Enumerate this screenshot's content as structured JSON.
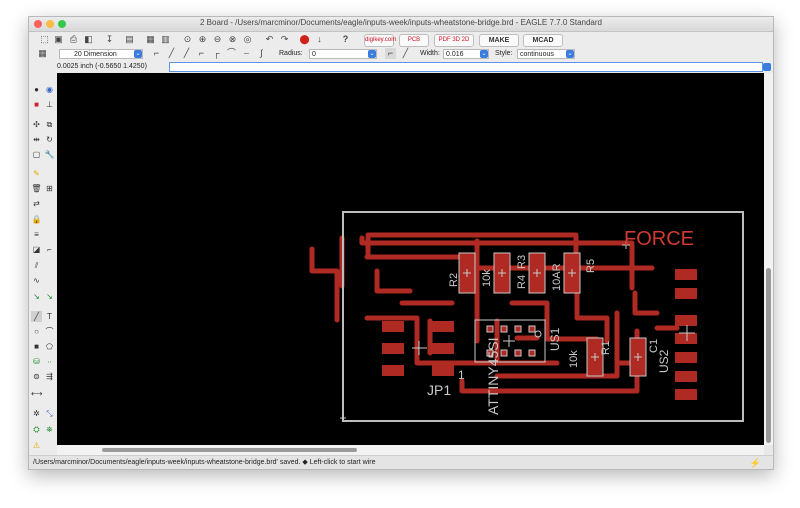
{
  "window": {
    "title": "2 Board - /Users/marcminor/Documents/eagle/inputs-week/inputs-wheatstone-bridge.brd - EAGLE 7.7.0 Standard"
  },
  "toolbar": {
    "buttons": [
      "digikey.com",
      "PCB quote",
      "PDF 3D 2D",
      "MAKE",
      "MCAD"
    ]
  },
  "props": {
    "layer": "20 Dimension",
    "radius_label": "Radius:",
    "radius_value": "0",
    "width_label": "Width:",
    "width_value": "0.016",
    "style_label": "Style:",
    "style_value": "continuous"
  },
  "cmd": {
    "coordinates": "0.0025 inch (-0.5650 1.4250)",
    "command": ""
  },
  "board": {
    "labels": {
      "force": "FORCE",
      "r2": "R2",
      "val10k_a": "10k",
      "r4": "R4",
      "r3": "R3",
      "val10ar": "10AR",
      "r5": "R5",
      "us1": "US1",
      "val10k_b": "10k",
      "r1": "R1",
      "c1": "C1",
      "us2": "US2",
      "attiny": "ATTINY45SI",
      "jp1": "JP1",
      "pin1": "1"
    },
    "colors": {
      "background": "#000000",
      "outline": "#bdbdbd",
      "trace": "#b02a24",
      "label": "#c9c9c9",
      "force_text": "#d13a33"
    }
  },
  "status": {
    "text": "/Users/marcminor/Documents/eagle/inputs-week/inputs-wheatstone-bridge.brd' saved.  ◆ Left-click to start wire"
  }
}
